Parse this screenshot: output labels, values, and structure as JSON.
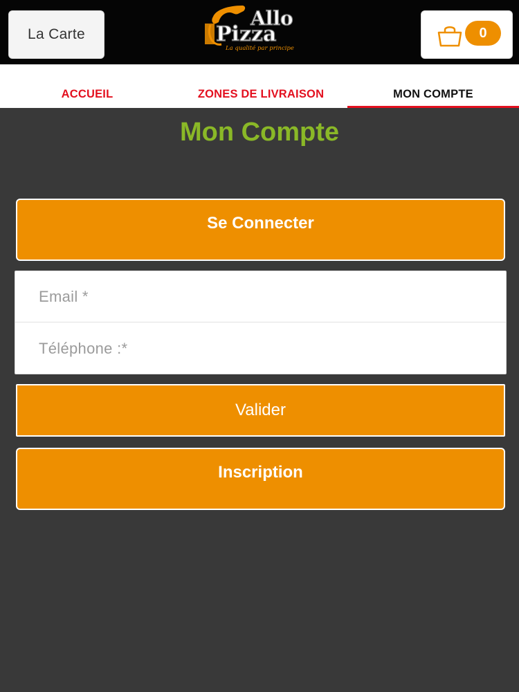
{
  "header": {
    "carte_label": "La Carte",
    "cart_count": "0",
    "logo": {
      "line1": "Allo",
      "line2": "Pizza",
      "tagline": "La qualité par principe"
    }
  },
  "nav": {
    "items": [
      {
        "label": "ACCUEIL",
        "active": false
      },
      {
        "label": "ZONES DE LIVRAISON",
        "active": false
      },
      {
        "label": "MON COMPTE",
        "active": true
      }
    ]
  },
  "main": {
    "title": "Mon Compte",
    "connect_label": "Se Connecter",
    "email_placeholder": "Email *",
    "phone_placeholder": "Téléphone :*",
    "submit_label": "Valider",
    "signup_label": "Inscription"
  },
  "colors": {
    "brand_orange": "#ee8f00",
    "title_green": "#8ab827",
    "nav_red": "#e3101f",
    "background_dark": "#393939"
  }
}
